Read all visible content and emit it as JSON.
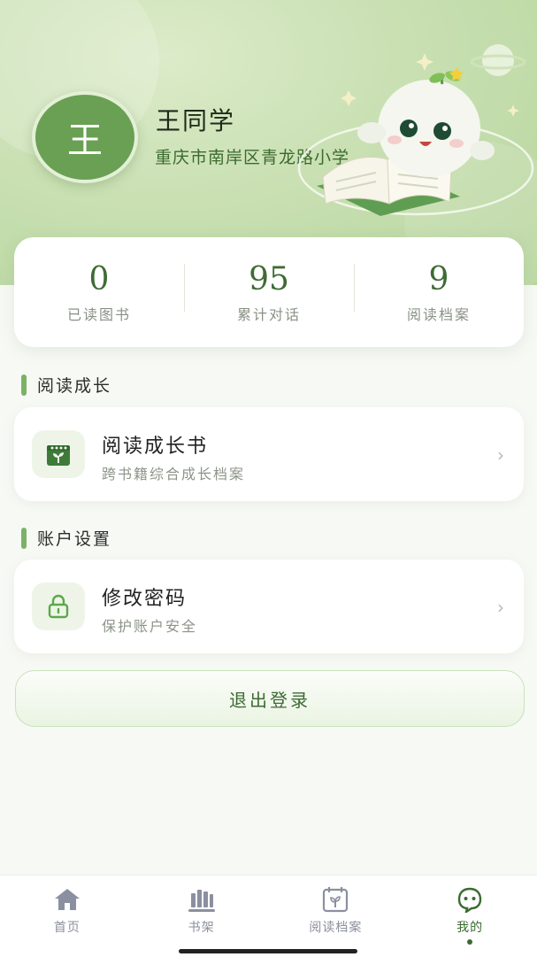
{
  "profile": {
    "avatar_char": "王",
    "name": "王同学",
    "school": "重庆市南岸区青龙路小学"
  },
  "stats": [
    {
      "value": "0",
      "label": "已读图书"
    },
    {
      "value": "95",
      "label": "累计对话"
    },
    {
      "value": "9",
      "label": "阅读档案"
    }
  ],
  "sections": {
    "growth": {
      "title": "阅读成长",
      "card_title": "阅读成长书",
      "card_sub": "跨书籍综合成长档案",
      "icon": "sprout-calendar-icon"
    },
    "account": {
      "title": "账户设置",
      "card_title": "修改密码",
      "card_sub": "保护账户安全",
      "icon": "lock-icon"
    }
  },
  "logout_label": "退出登录",
  "tabs": [
    {
      "label": "首页",
      "icon": "home-icon"
    },
    {
      "label": "书架",
      "icon": "bookshelf-icon"
    },
    {
      "label": "阅读档案",
      "icon": "calendar-sprout-icon"
    },
    {
      "label": "我的",
      "icon": "face-icon",
      "active": true
    }
  ],
  "colors": {
    "accent": "#3f6b35",
    "brand_green": "#7bb266"
  }
}
